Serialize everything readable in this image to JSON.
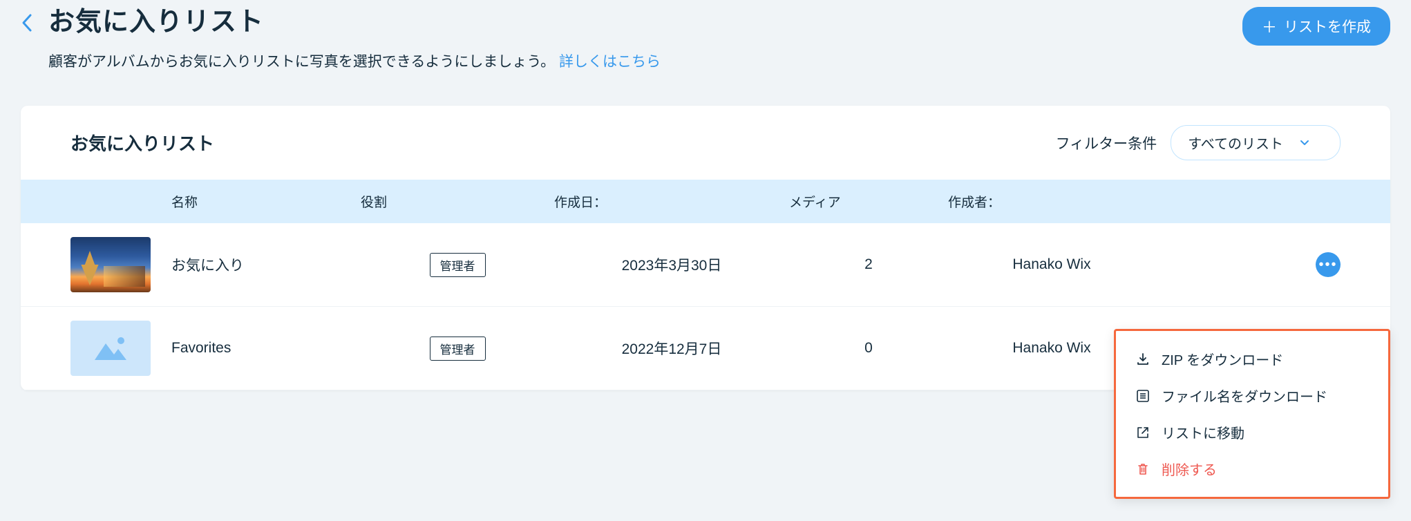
{
  "header": {
    "title": "お気に入りリスト",
    "subtitle": "顧客がアルバムからお気に入りリストに写真を選択できるようにしましょう。",
    "subtitle_link": "詳しくはこちら",
    "create_button": "リストを作成"
  },
  "card": {
    "title": "お気に入りリスト",
    "filter_label": "フィルター条件",
    "filter_value": "すべてのリスト"
  },
  "table": {
    "columns": {
      "name": "名称",
      "role": "役割",
      "created": "作成日：",
      "media": "メディア",
      "creator": "作成者："
    },
    "rows": [
      {
        "name": "お気に入り",
        "role": "管理者",
        "created": "2023年3月30日",
        "media": "2",
        "creator": "Hanako Wix",
        "thumb_type": "photo"
      },
      {
        "name": "Favorites",
        "role": "管理者",
        "created": "2022年12月7日",
        "media": "0",
        "creator": "Hanako Wix",
        "thumb_type": "placeholder"
      }
    ]
  },
  "menu": {
    "download_zip": "ZIP をダウンロード",
    "download_filenames": "ファイル名をダウンロード",
    "go_to_list": "リストに移動",
    "delete": "削除する"
  }
}
